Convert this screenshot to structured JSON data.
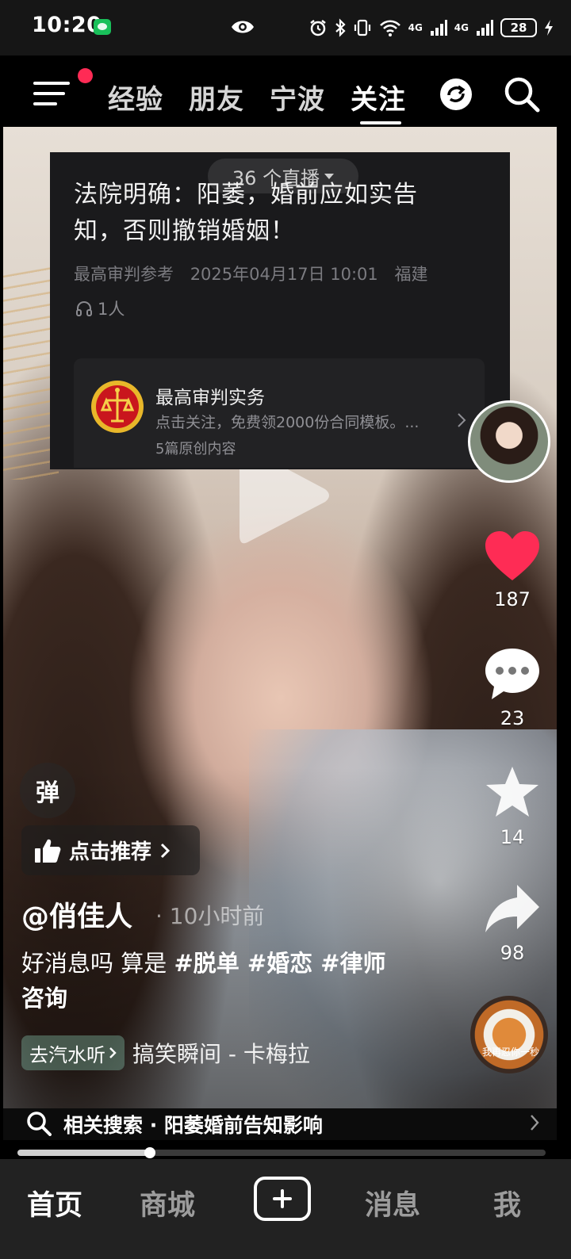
{
  "status_bar": {
    "time": "10:20",
    "network_left": "4G",
    "network_right": "4G",
    "battery": "28"
  },
  "top_nav": {
    "tabs": [
      {
        "label": "经验"
      },
      {
        "label": "朋友"
      },
      {
        "label": "宁波"
      },
      {
        "label": "关注"
      }
    ],
    "active_tab": "关注",
    "icons": [
      "menu-icon",
      "refresh-icon",
      "search-icon"
    ]
  },
  "article": {
    "live_pill": "36 个直播",
    "title": "法院明确：阳萎，婚前应如实告知，否则撤销婚姻！",
    "source": "最高审判参考",
    "date": "2025年04月17日 10:01",
    "location": "福建",
    "listeners": "1人",
    "account": {
      "name": "最高审判实务",
      "desc": "点击关注，免费领2000份合同模板。...",
      "count": "5篇原创内容"
    }
  },
  "rail": {
    "likes": "187",
    "comments": "23",
    "favorites": "14",
    "shares": "98",
    "music_disc_text": "我再忍你一秒"
  },
  "overlay": {
    "danmaku": "弹",
    "recommend": "点击推荐",
    "author": "@俏佳人",
    "time": "· 10小时前",
    "caption_plain": "好消息吗 算是 ",
    "caption_tags": "#脱单 #婚恋 #律师咨询",
    "qishui": "去汽水听",
    "music_title": "搞笑瞬间 - 卡梅拉"
  },
  "related": {
    "text": "相关搜索 · 阳萎婚前告知影响"
  },
  "progress": {
    "fraction": 0.25
  },
  "bottom_nav": {
    "tabs": [
      "首页",
      "商城",
      "消息",
      "我"
    ],
    "active": "首页"
  },
  "colors": {
    "accent_red": "#ff2b55",
    "like_red": "#fe2c55",
    "status_bg": "#161616",
    "bottom_bg": "#222222"
  }
}
